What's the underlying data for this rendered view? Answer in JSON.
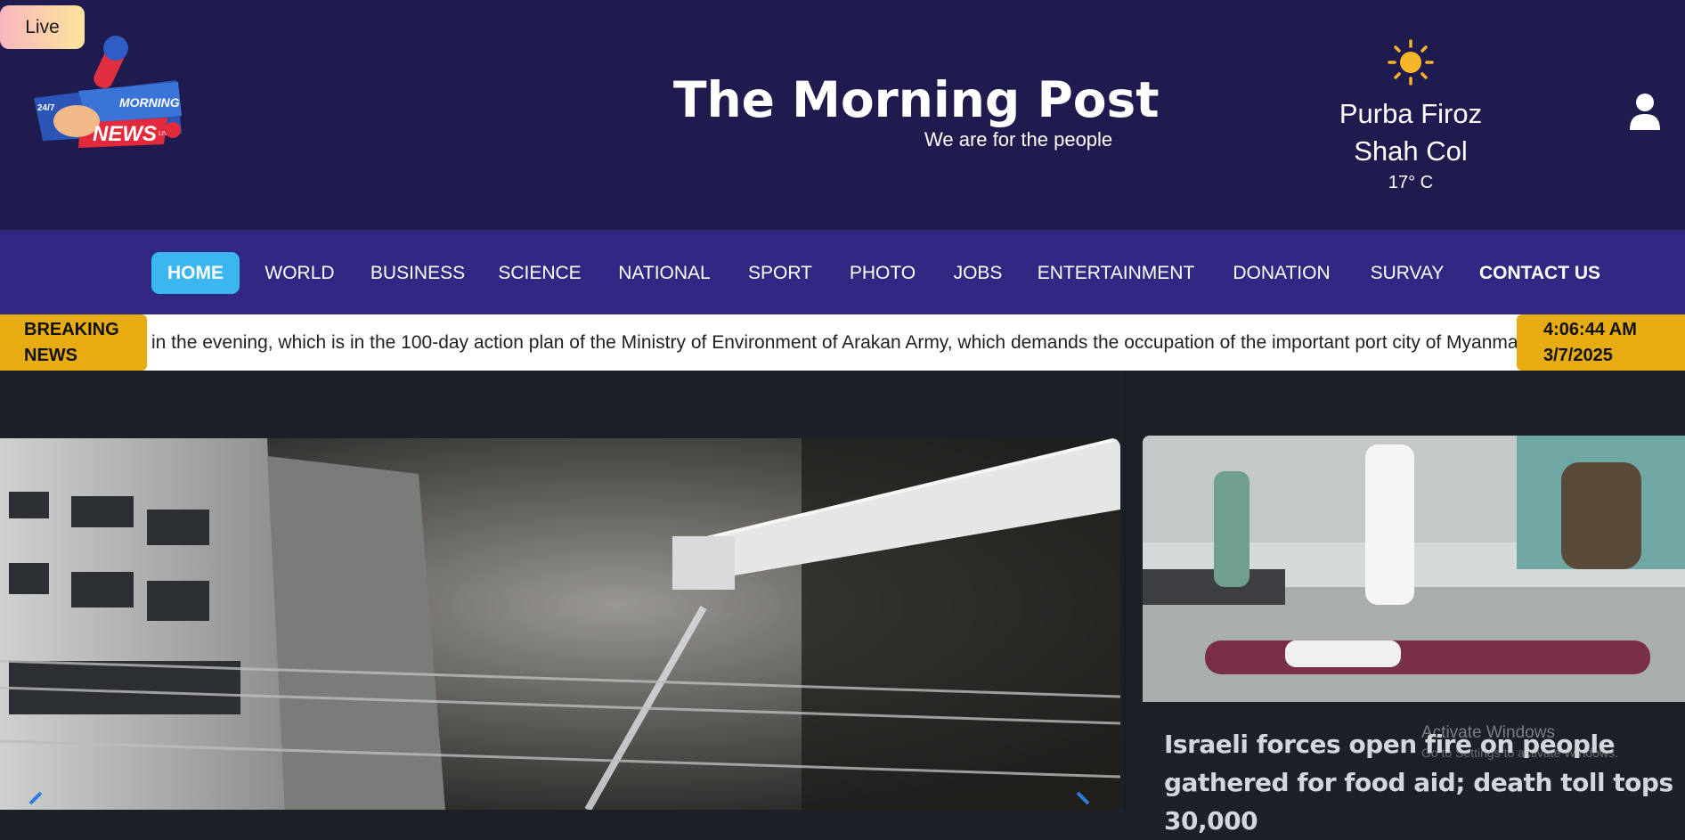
{
  "header": {
    "live_label": "Live",
    "site_title": "The Morning Post",
    "tagline": "We are for the people",
    "logo": {
      "line1": "24/7",
      "line2": "MORNING",
      "line3": "NEWS",
      "line4": "LIVE"
    }
  },
  "weather": {
    "icon": "sun-icon",
    "city_line1": "Purba Firoz",
    "city_line2": "Shah Col",
    "temperature": "17° C"
  },
  "user": {
    "icon": "user-icon"
  },
  "nav": {
    "items": [
      {
        "label": "HOME",
        "active": true
      },
      {
        "label": "WORLD"
      },
      {
        "label": "BUSINESS"
      },
      {
        "label": "SCIENCE"
      },
      {
        "label": "NATIONAL"
      },
      {
        "label": "SPORT"
      },
      {
        "label": "PHOTO"
      },
      {
        "label": "JOBS"
      },
      {
        "label": "ENTERTAINMENT"
      },
      {
        "label": "DONATION"
      },
      {
        "label": "SURVAY"
      },
      {
        "label": "CONTACT US"
      }
    ]
  },
  "ticker": {
    "label_line1": "BREAKING",
    "label_line2": "NEWS",
    "text": "in the evening, which is in the 100-day action plan of the Ministry of Environment of Arakan Army, which demands the occupation of the important port city of Myanmar",
    "time": "4:06:44 AM",
    "date": "3/7/2025"
  },
  "featured": {
    "side_headline": "Israeli forces open fire on people gathered for food aid; death toll tops 30,000"
  },
  "watermark": {
    "title": "Activate Windows",
    "subtitle": "Go to Settings to activate Windows."
  },
  "colors": {
    "header_bg": "#1f1b4f",
    "nav_bg": "#302882",
    "nav_active": "#3bb6ef",
    "ticker_accent": "#e6ac12",
    "page_bg": "#1c2128"
  }
}
